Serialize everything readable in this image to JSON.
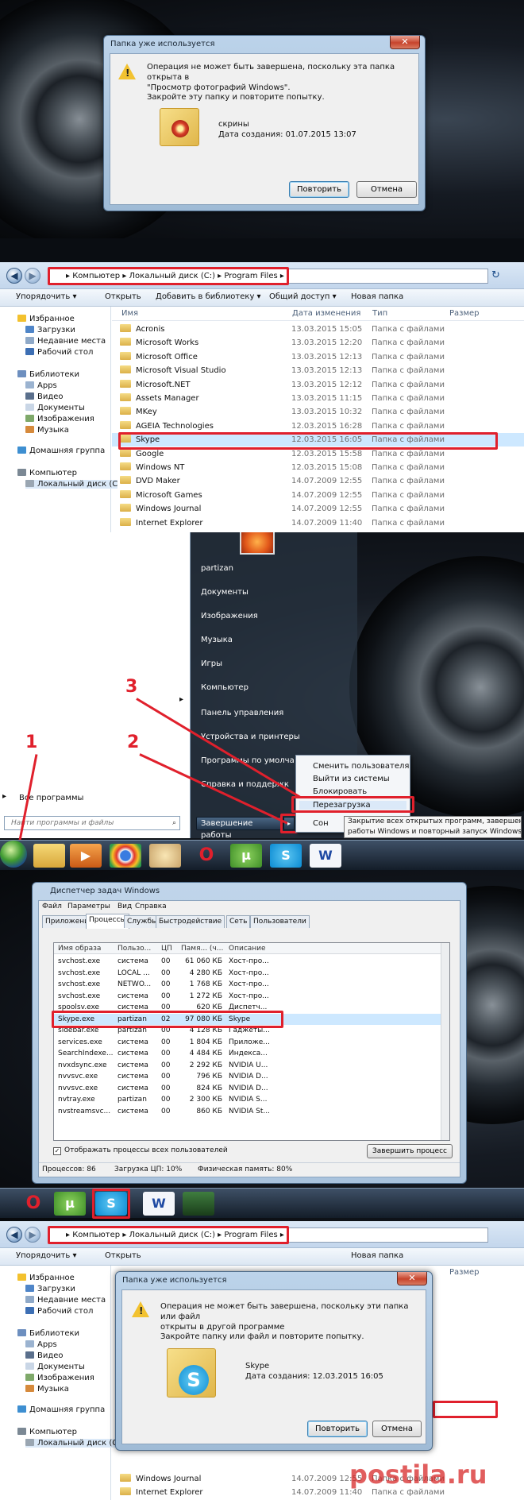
{
  "dialog1": {
    "title": "Папка уже используется",
    "close": "✕",
    "message_line1": "Операция не может быть завершена, поскольку эта папка открыта в",
    "message_line2": "\"Просмотр фотографий Windows\".",
    "instruction": "Закройте эту папку и повторите попытку.",
    "folder_name": "скрины",
    "created": "Дата создания: 01.07.2015 13:07",
    "retry": "Повторить",
    "cancel": "Отмена"
  },
  "explorer1": {
    "crumbs": "▸ Компьютер ▸ Локальный диск (C:) ▸ Program Files ▸",
    "toolbar": [
      "Упорядочить ▾",
      "Открыть",
      "Добавить в библиотеку ▾",
      "Общий доступ ▾",
      "Новая папка"
    ],
    "columns": {
      "name": "Имя",
      "date": "Дата изменения",
      "type": "Тип",
      "size": "Размер"
    },
    "nav": [
      "Избранное",
      "Загрузки",
      "Недавние места",
      "Рабочий стол",
      "Библиотеки",
      "Apps",
      "Видео",
      "Документы",
      "Изображения",
      "Музыка",
      "Домашняя группа",
      "Компьютер",
      "Локальный диск (C"
    ],
    "rows": [
      {
        "name": "Acronis",
        "date": "13.03.2015 15:05",
        "type": "Папка с файлами"
      },
      {
        "name": "Microsoft Works",
        "date": "13.03.2015 12:20",
        "type": "Папка с файлами"
      },
      {
        "name": "Microsoft Office",
        "date": "13.03.2015 12:13",
        "type": "Папка с файлами"
      },
      {
        "name": "Microsoft Visual Studio",
        "date": "13.03.2015 12:13",
        "type": "Папка с файлами"
      },
      {
        "name": "Microsoft.NET",
        "date": "13.03.2015 12:12",
        "type": "Папка с файлами"
      },
      {
        "name": "Assets Manager",
        "date": "13.03.2015 11:15",
        "type": "Папка с файлами"
      },
      {
        "name": "MKey",
        "date": "13.03.2015 10:32",
        "type": "Папка с файлами"
      },
      {
        "name": "AGEIA Technologies",
        "date": "12.03.2015 16:28",
        "type": "Папка с файлами"
      },
      {
        "name": "Skype",
        "date": "12.03.2015 16:05",
        "type": "Папка с файлами"
      },
      {
        "name": "Google",
        "date": "12.03.2015 15:58",
        "type": "Папка с файлами"
      },
      {
        "name": "Windows NT",
        "date": "12.03.2015 15:08",
        "type": "Папка с файлами"
      },
      {
        "name": "DVD Maker",
        "date": "14.07.2009 12:55",
        "type": "Папка с файлами"
      },
      {
        "name": "Microsoft Games",
        "date": "14.07.2009 12:55",
        "type": "Папка с файлами"
      },
      {
        "name": "Windows Journal",
        "date": "14.07.2009 12:55",
        "type": "Папка с файлами"
      },
      {
        "name": "Internet Explorer",
        "date": "14.07.2009 11:40",
        "type": "Папка с файлами"
      }
    ]
  },
  "startmenu": {
    "right_items": [
      "partizan",
      "Документы",
      "Изображения",
      "Музыка",
      "Игры",
      "Компьютер",
      "Панель управления",
      "Устройства и принтеры",
      "Программы по умолча",
      "Справка и поддержк"
    ],
    "all_programs": "Все программы",
    "search_placeholder": "Найти программы и файлы",
    "shutdown": "Завершение работы",
    "popup": [
      "Сменить пользователя",
      "Выйти из системы",
      "Блокировать",
      "Перезагрузка",
      "Сон"
    ],
    "tooltip_line1": "Закрытие всех открытых программ, завершение",
    "tooltip_line2": "работы Windows и повторный запуск Windows.",
    "n1": "1",
    "n2": "2",
    "n3": "3"
  },
  "taskmgr": {
    "title": "Диспетчер задач Windows",
    "menu": [
      "Файл",
      "Параметры",
      "Вид",
      "Справка"
    ],
    "tabs": [
      "Приложения",
      "Процессы",
      "Службы",
      "Быстродействие",
      "Сеть",
      "Пользователи"
    ],
    "headers": [
      "Имя образа",
      "Пользо...",
      "ЦП",
      "Памя... (ч...",
      "Описание"
    ],
    "rows": [
      [
        "svchost.exe",
        "система",
        "00",
        "61 060 КБ",
        "Хост-про..."
      ],
      [
        "svchost.exe",
        "LOCAL ...",
        "00",
        "4 280 КБ",
        "Хост-про..."
      ],
      [
        "svchost.exe",
        "NETWO...",
        "00",
        "1 768 КБ",
        "Хост-про..."
      ],
      [
        "svchost.exe",
        "система",
        "00",
        "1 272 КБ",
        "Хост-про..."
      ],
      [
        "spoolsv.exe",
        "система",
        "00",
        "620 КБ",
        "Диспетч..."
      ],
      [
        "Skype.exe",
        "partizan",
        "02",
        "97 080 КБ",
        "Skype"
      ],
      [
        "sidebar.exe",
        "partizan",
        "00",
        "4 128 КБ",
        "Гаджеты..."
      ],
      [
        "services.exe",
        "система",
        "00",
        "1 804 КБ",
        "Приложе..."
      ],
      [
        "SearchIndexe...",
        "система",
        "00",
        "4 484 КБ",
        "Индекса..."
      ],
      [
        "nvxdsync.exe",
        "система",
        "00",
        "2 292 КБ",
        "NVIDIA U..."
      ],
      [
        "nvvsvc.exe",
        "система",
        "00",
        "796 КБ",
        "NVIDIA D..."
      ],
      [
        "nvvsvc.exe",
        "система",
        "00",
        "824 КБ",
        "NVIDIA D..."
      ],
      [
        "nvtray.exe",
        "partizan",
        "00",
        "2 300 КБ",
        "NVIDIA S..."
      ],
      [
        "nvstreamsvc...",
        "система",
        "00",
        "860 КБ",
        "NVIDIA St..."
      ]
    ],
    "show_all": "Отображать процессы всех пользователей",
    "end_process": "Завершить процесс",
    "status": [
      "Процессов: 86",
      "Загрузка ЦП: 10%",
      "Физическая память: 80%"
    ]
  },
  "dialog2": {
    "title": "Папка уже используется",
    "close": "✕",
    "message_line1": "Операция не может быть завершена, поскольку эти папка или файл",
    "message_line2": "открыты в другой программе",
    "instruction": "Закройте папку или файл и повторите попытку.",
    "folder_name": "Skype",
    "created": "Дата создания: 12.03.2015 16:05",
    "retry": "Повторить",
    "cancel": "Отмена",
    "bg_rows": [
      {
        "name": "Windows Journal",
        "date": "14.07.2009 12:55",
        "type": "Папка с файлами"
      },
      {
        "name": "Internet Explorer",
        "date": "14.07.2009 11:40",
        "type": "Папка с файлами"
      }
    ],
    "size_col": "Размер"
  },
  "watermark": "postila.ru",
  "colors": {
    "highlight": "#e0202c",
    "selection": "#cde8ff"
  }
}
